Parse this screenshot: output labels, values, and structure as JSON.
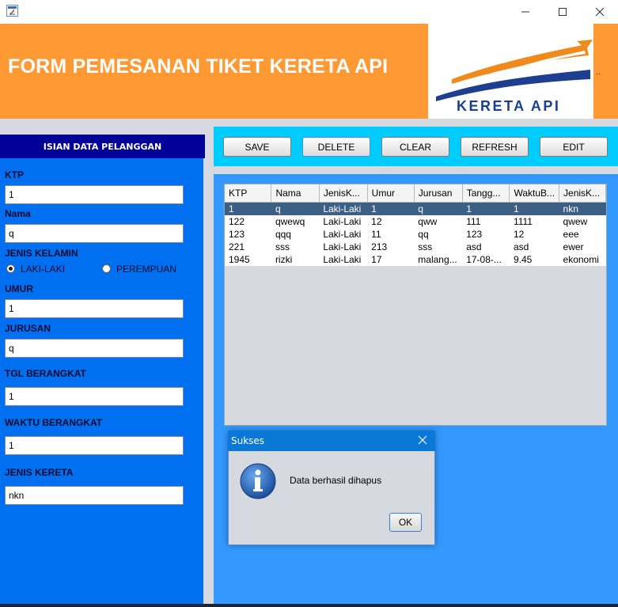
{
  "window": {
    "title": ""
  },
  "header": {
    "title": "FORM PEMESANAN TIKET KERETA API",
    "logo_text": "KERETA API",
    "dots": ".."
  },
  "form": {
    "panel_title": "ISIAN DATA PELANGGAN",
    "ktp_label": "KTP",
    "ktp_value": "1",
    "nama_label": "Nama",
    "nama_value": "q",
    "gender_label": "JENIS KELAMIN",
    "gender_options": [
      "LAKI-LAKI",
      "PEREMPUAN"
    ],
    "gender_selected": "LAKI-LAKI",
    "umur_label": "UMUR",
    "umur_value": "1",
    "jurusan_label": "JURUSAN",
    "jurusan_value": "q",
    "tgl_label": "TGL BERANGKAT",
    "tgl_value": "1",
    "waktu_label": "WAKTU BERANGKAT",
    "waktu_value": "1",
    "kereta_label": "JENIS KERETA",
    "kereta_value": "nkn"
  },
  "toolbar": {
    "save": "SAVE",
    "delete": "DELETE",
    "clear": "CLEAR",
    "refresh": "REFRESH",
    "edit": "EDIT"
  },
  "table": {
    "columns": [
      "KTP",
      "Nama",
      "JenisK...",
      "Umur",
      "Jurusan",
      "Tangg...",
      "WaktuB...",
      "JenisK..."
    ],
    "rows": [
      [
        "1",
        "q",
        "Laki-Laki",
        "1",
        "q",
        "1",
        "1",
        "nkn"
      ],
      [
        "122",
        "qwewq",
        "Laki-Laki",
        "12",
        "qww",
        "111",
        "1111",
        "qwew"
      ],
      [
        "123",
        "qqq",
        "Laki-Laki",
        "11",
        "qq",
        "123",
        "12",
        "eee"
      ],
      [
        "221",
        "sss",
        "Laki-Laki",
        "213",
        "sss",
        "asd",
        "asd",
        "ewer"
      ],
      [
        "1945",
        "rizki",
        "Laki-Laki",
        "17",
        "malang...",
        "17-08-...",
        "9.45",
        "ekonomi"
      ]
    ],
    "selected_row": 0
  },
  "dialog": {
    "title": "Sukses",
    "message": "Data berhasil dihapus",
    "ok_label": "OK",
    "icon": "info-icon"
  },
  "colors": {
    "header": "#ff9933",
    "left_panel": "#0070f0",
    "toolbar": "#00ccff",
    "table_area": "#3399ff",
    "panel_title_bg": "#000099"
  }
}
